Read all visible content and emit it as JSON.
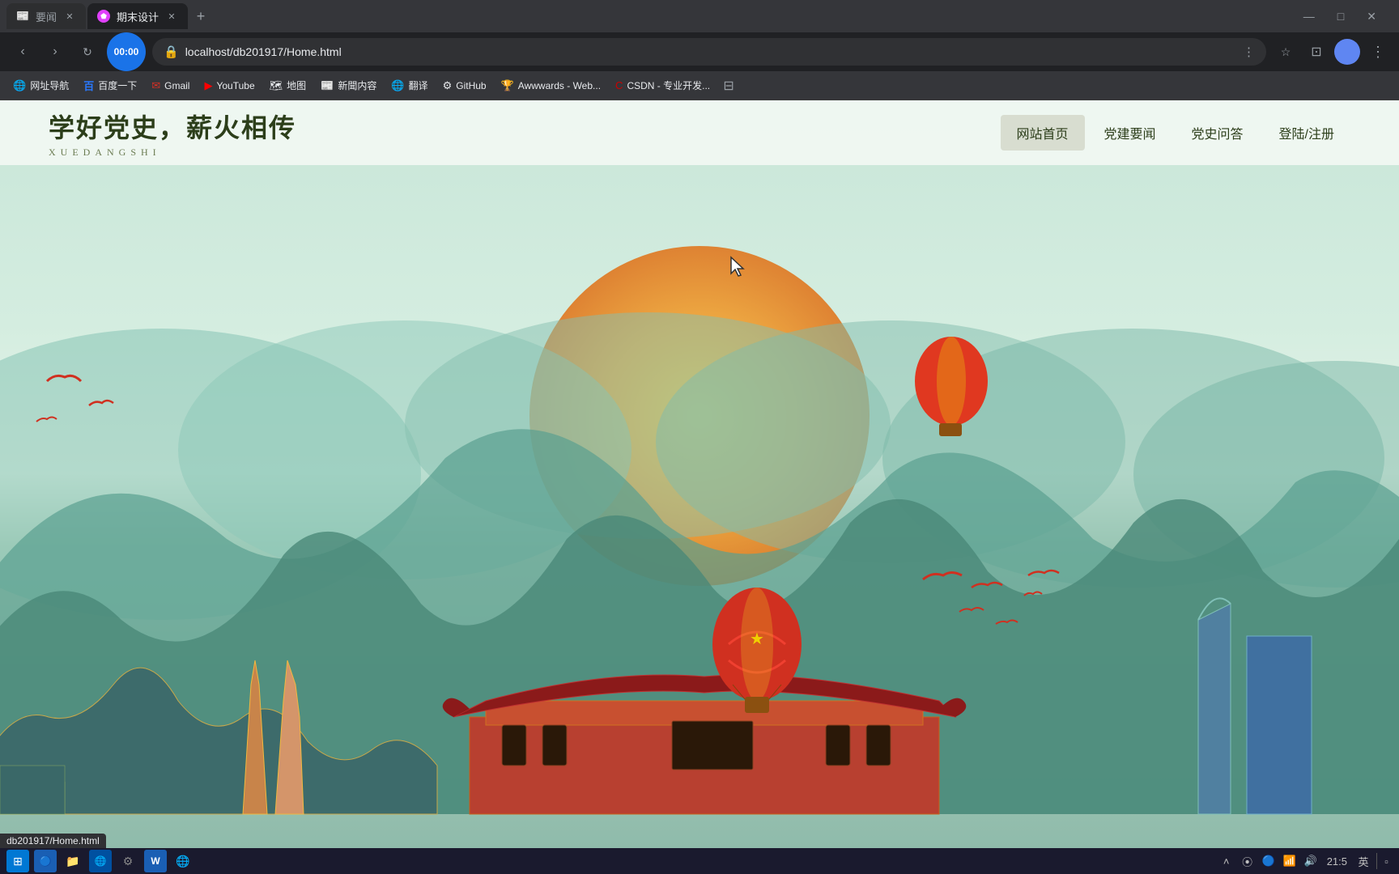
{
  "browser": {
    "tabs": [
      {
        "id": "tab1",
        "label": "要闻",
        "active": false,
        "favicon": "📰"
      },
      {
        "id": "tab2",
        "label": "期末设计",
        "active": true,
        "favicon": "🎨"
      }
    ],
    "new_tab_label": "+",
    "address": "localhost/db201917/Home.html",
    "address_secure_icon": "🔒",
    "timer": "00:00",
    "window_controls": [
      "—",
      "□",
      "×"
    ]
  },
  "bookmarks": [
    {
      "id": "bm1",
      "label": "网址导航",
      "icon": "🌐"
    },
    {
      "id": "bm2",
      "label": "百度一下",
      "icon": "🔵"
    },
    {
      "id": "bm3",
      "label": "Gmail",
      "icon": "✉"
    },
    {
      "id": "bm4",
      "label": "YouTube",
      "icon": "▶"
    },
    {
      "id": "bm5",
      "label": "地图",
      "icon": "🗺"
    },
    {
      "id": "bm6",
      "label": "新聞内容",
      "icon": "📰"
    },
    {
      "id": "bm7",
      "label": "翻译",
      "icon": "🌐"
    },
    {
      "id": "bm8",
      "label": "GitHub",
      "icon": "⚙"
    },
    {
      "id": "bm9",
      "label": "Awwwards - Web...",
      "icon": "🏆"
    },
    {
      "id": "bm10",
      "label": "CSDN - 专业开发...",
      "icon": "💻"
    }
  ],
  "site": {
    "title": "学好党史，薪火相传",
    "subtitle": "XUEDANGSHI",
    "nav": [
      {
        "id": "nav1",
        "label": "网站首页",
        "active": true
      },
      {
        "id": "nav2",
        "label": "党建要闻",
        "active": false
      },
      {
        "id": "nav3",
        "label": "党史问答",
        "active": false
      },
      {
        "id": "nav4",
        "label": "登陆/注册",
        "active": false
      }
    ]
  },
  "taskbar": {
    "items": [
      {
        "id": "tb1",
        "icon": "⊞",
        "color": "#0078d4"
      },
      {
        "id": "tb2",
        "icon": "🔵",
        "color": "#0078d4"
      },
      {
        "id": "tb3",
        "icon": "📁",
        "color": "#f0a030"
      },
      {
        "id": "tb4",
        "icon": "🌐",
        "color": "#0078d4"
      },
      {
        "id": "tb5",
        "icon": "⚙",
        "color": "#888"
      },
      {
        "id": "tb6",
        "icon": "W",
        "color": "#1a5fb4"
      },
      {
        "id": "tb7",
        "icon": "🌐",
        "color": "#34a853"
      }
    ],
    "time": "21:5",
    "date": "",
    "lang": "英",
    "status_url": "db201917/Home.html"
  }
}
